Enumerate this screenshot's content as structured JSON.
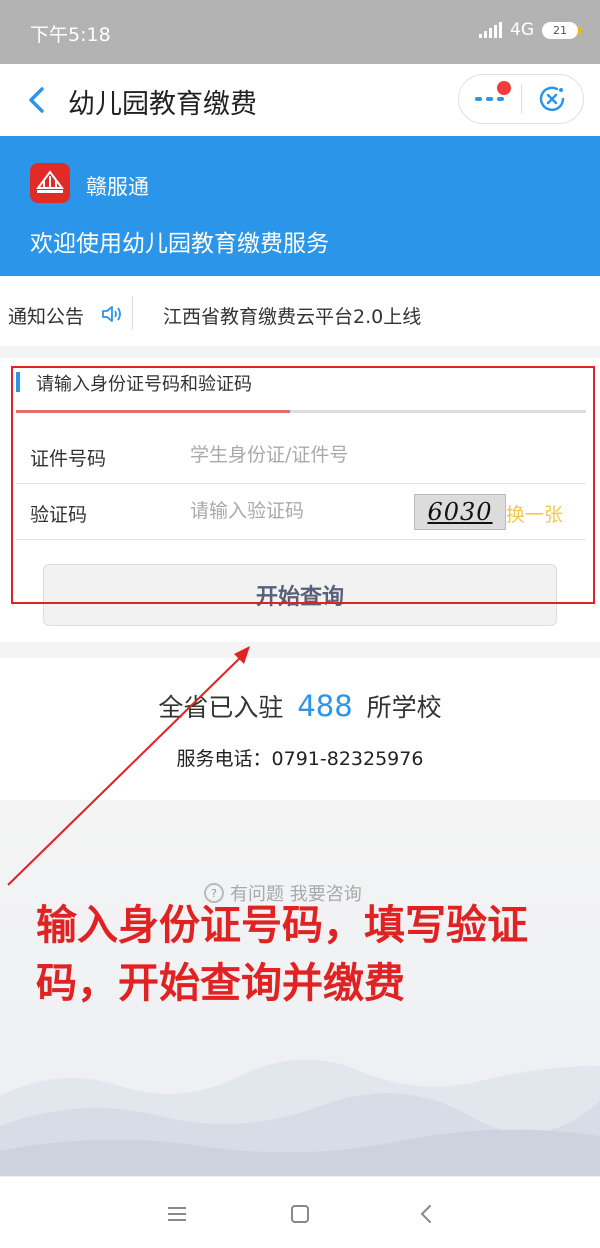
{
  "status_bar": {
    "time": "下午5:18",
    "network": "4G",
    "battery": "21"
  },
  "nav": {
    "title": "幼儿园教育缴费"
  },
  "banner": {
    "app_name": "赣服通",
    "welcome": "欢迎使用幼儿园教育缴费服务"
  },
  "notice": {
    "label": "通知公告",
    "text": "江西省教育缴费云平台2.0上线"
  },
  "form": {
    "heading": "请输入身份证号码和验证码",
    "progress": 0.48,
    "id_label": "证件号码",
    "id_placeholder": "学生身份证/证件号",
    "code_label": "验证码",
    "code_placeholder": "请输入验证码",
    "captcha_text": "6030",
    "refresh_label": "换一张",
    "submit_label": "开始查询"
  },
  "stats": {
    "prefix": "全省已入驻",
    "count": "488",
    "suffix": "所学校",
    "phone": "服务电话：0791-82325976"
  },
  "footer": {
    "consult": "有问题 我要咨询"
  },
  "annotation": {
    "text": "输入身份证号码，填写验证码，开始查询并缴费"
  },
  "colors": {
    "brand_blue": "#2b95e9",
    "annotation_red": "#e02222",
    "refresh_yellow": "#f2c94c"
  }
}
